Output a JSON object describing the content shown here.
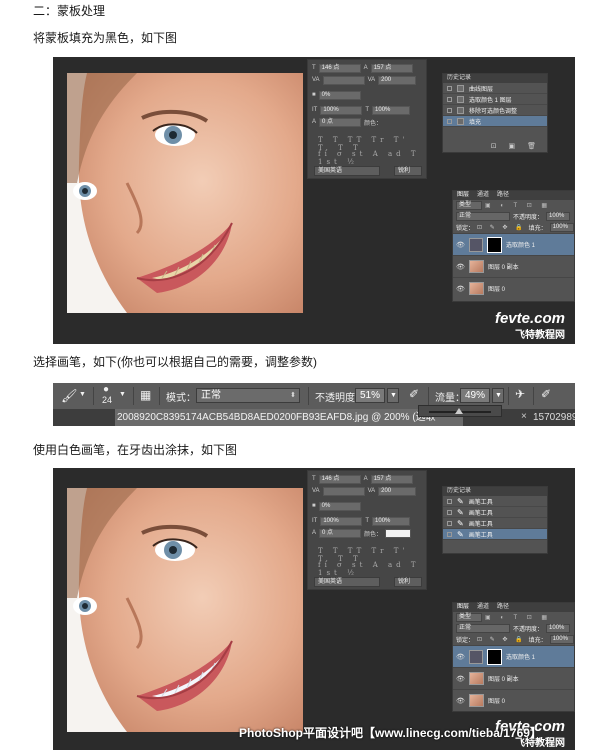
{
  "sections": {
    "heading": "二：蒙板处理",
    "step1": "将蒙板填充为黑色，如下图",
    "step2": "选择画笔，如下(你也可以根据自己的需要，调整参数)",
    "step3": "使用白色画笔，在牙齿出涂抹，如下图"
  },
  "shot1": {
    "char": {
      "font_size": "146 点",
      "leading": "157 点",
      "tracking_label": "VA",
      "tracking": "200",
      "baseline": "0%",
      "vscale": "100%",
      "hscale": "100%",
      "shift": "0 点",
      "color_label": "颜色：",
      "tt": "T T TT Tr T' T, T T",
      "frac": "fi  σ  st  A  ad  T  1st  ½",
      "lang": "美国英语",
      "aa": "锐利"
    },
    "history": {
      "title": "历史记录",
      "items": [
        "曲线图层",
        "选取颜色 1 图层",
        "移除可选颜色调整",
        "填充"
      ]
    },
    "layers": {
      "tabs": [
        "图层",
        "通道",
        "路径"
      ],
      "kind": "类型",
      "blend": "正常",
      "opacity_label": "不透明度：",
      "opacity": "100%",
      "lock_label": "锁定：",
      "fill_label": "填充：",
      "fill": "100%",
      "rows": [
        "选取颜色 1",
        "图层 0 副本",
        "图层 0"
      ]
    },
    "wm_fe": "fevte.com",
    "wm_cn": "飞特教程网"
  },
  "optbar": {
    "brush_size": "24",
    "mode_label": "模式：",
    "mode": "正常",
    "opacity_label": "不透明度：",
    "opacity": "51%",
    "flow_label": "流量：",
    "flow": "49%",
    "doc_tab": "2008920C8395174ACB54BD8AED0200FB93EAFD8.jpg @ 200% (选取",
    "doc_tab2": "15702989"
  },
  "shot2": {
    "char": {
      "font_size": "146 点",
      "leading": "157 点",
      "tracking_label": "VA",
      "tracking": "200",
      "baseline": "0%",
      "vscale": "100%",
      "hscale": "100%",
      "shift": "0 点",
      "color_label": "颜色：",
      "tt": "T T TT Tr T' T, T T",
      "frac": "fi  σ  st  A  ad  T  1st  ½",
      "lang": "美国英语",
      "aa": "锐利"
    },
    "history": {
      "title": "历史记录",
      "items": [
        "画笔工具",
        "画笔工具",
        "画笔工具",
        "画笔工具"
      ]
    },
    "layers": {
      "tabs": [
        "图层",
        "通道",
        "路径"
      ],
      "kind": "类型",
      "blend": "正常",
      "opacity_label": "不透明度：",
      "opacity": "100%",
      "lock_label": "锁定：",
      "fill_label": "填充：",
      "fill": "100%",
      "rows": [
        "选取颜色 1",
        "图层 0 副本",
        "图层 0"
      ]
    },
    "wm_fe": "fevte.com",
    "wm_cn": "飞特教程网",
    "wm_bottom": "PhotoShop平面设计吧【www.linecg.com/tieba/1769】"
  }
}
